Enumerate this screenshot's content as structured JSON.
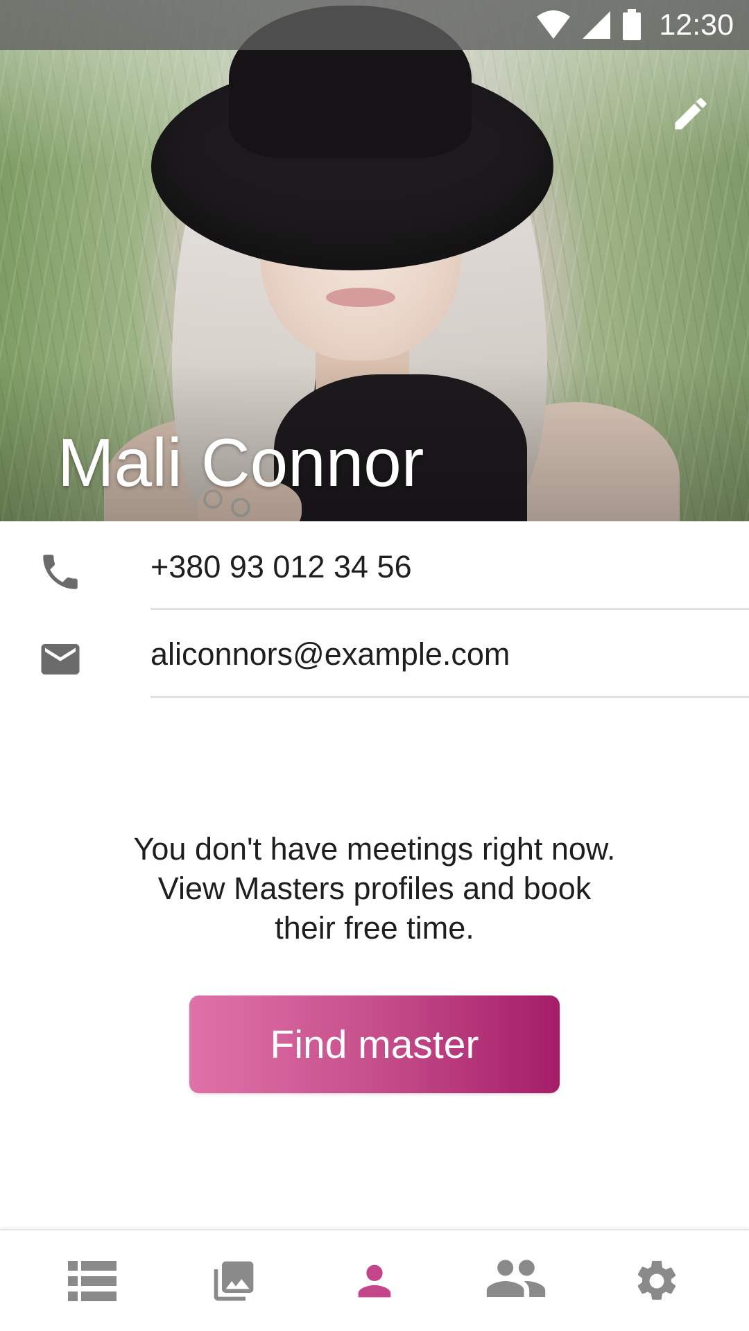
{
  "status_bar": {
    "time": "12:30",
    "icons": [
      "wifi-icon",
      "cellular-signal-icon",
      "battery-icon"
    ]
  },
  "profile": {
    "name": "Mali Connor",
    "photo": "profile-photo",
    "edit_icon": "pencil-icon"
  },
  "contacts": {
    "phone": {
      "icon": "phone-icon",
      "value": "+380 93 012 34 56"
    },
    "email": {
      "icon": "mail-icon",
      "value": "aliconnors@example.com"
    }
  },
  "empty_state": {
    "lines": [
      "You don't have meetings right now.",
      "View Masters profiles and book",
      "their free time."
    ],
    "button_label": "Find master"
  },
  "bottom_nav": {
    "items": [
      {
        "icon": "list-icon",
        "active": false
      },
      {
        "icon": "gallery-icon",
        "active": false
      },
      {
        "icon": "person-icon",
        "active": true
      },
      {
        "icon": "people-icon",
        "active": false
      },
      {
        "icon": "settings-gear-icon",
        "active": false
      }
    ]
  },
  "colors": {
    "accent_start": "#df72a9",
    "accent_end": "#a41d68",
    "active_nav": "#c4458a",
    "inactive_nav": "#8a8a8a",
    "icon_gray": "#6b6b6b"
  }
}
